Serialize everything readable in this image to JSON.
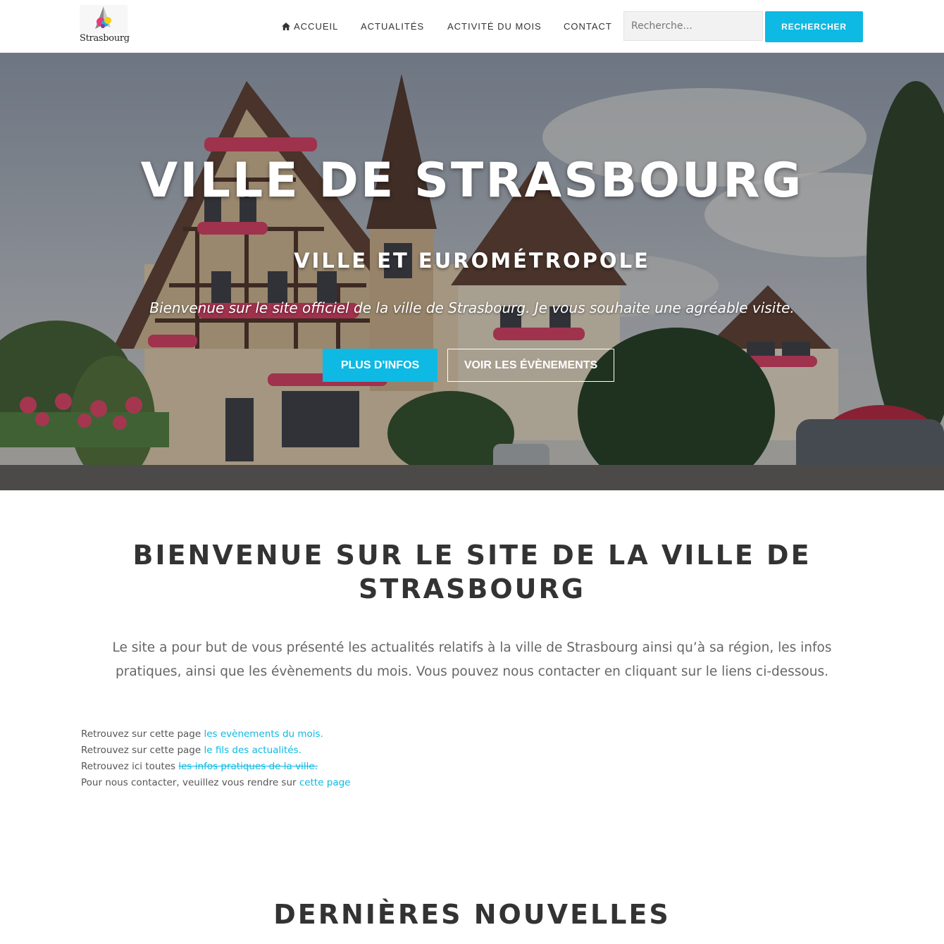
{
  "header": {
    "logo_text": "Strasbourg",
    "nav": [
      {
        "label": "ACCUEIL",
        "icon": "home-icon"
      },
      {
        "label": "ACTUALITÉS"
      },
      {
        "label": "ACTIVITÉ DU MOIS"
      },
      {
        "label": "CONTACT"
      }
    ],
    "search_placeholder": "Recherche...",
    "search_button": "RECHERCHER"
  },
  "hero": {
    "title": "VILLE DE STRASBOURG",
    "subtitle": "VILLE ET EUROMÉTROPOLE",
    "tagline": "Bienvenue sur le site officiel de la ville de Strasbourg. Je vous souhaite une agréable visite.",
    "primary_button": "PLUS D'INFOS",
    "secondary_button": "VOIR LES ÉVÈNEMENTS"
  },
  "welcome": {
    "title": "BIENVENUE SUR LE SITE DE LA VILLE DE STRASBOURG",
    "text": "Le site a pour but de vous présenté les actualités relatifs à la ville de Strasbourg ainsi qu’à sa région, les infos pratiques, ainsi que les évènements du mois. Vous pouvez nous contacter en cliquant sur le liens ci-dessous.",
    "links": [
      {
        "prefix": "Retrouvez sur cette page ",
        "link": "les evènements du mois."
      },
      {
        "prefix": "Retrouvez sur cette page ",
        "link": "le fils des actualités."
      },
      {
        "prefix": "Retrouvez ici toutes ",
        "link": "les infos pratiques de la ville."
      },
      {
        "prefix": "Pour nous contacter, veuillez vous rendre sur ",
        "link": "cette page"
      }
    ]
  },
  "news": {
    "title": "DERNIÈRES NOUVELLES"
  },
  "colors": {
    "accent": "#0eb9e3",
    "heading": "#333333",
    "body_text": "#666666"
  }
}
